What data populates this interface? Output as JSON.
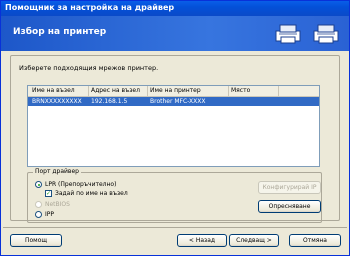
{
  "window": {
    "title": "Помощник за настройка на драйвер"
  },
  "header": {
    "title": "Избор на принтер"
  },
  "instruction": "Изберете подходящия мрежов принтер.",
  "table": {
    "columns": [
      "Име на възел",
      "Адрес на възел",
      "Име на принтер",
      "Място"
    ],
    "rows": [
      {
        "node_name": "BRNXXXXXXXXX",
        "node_address": "192.168.1.5",
        "printer_name": "Brother MFC-XXXX",
        "location": ""
      }
    ]
  },
  "port_group": {
    "legend": "Порт драйвер",
    "options": [
      {
        "label": "LPR (Препоръчително)",
        "checked": true,
        "enabled": true
      },
      {
        "label": "NetBIOS",
        "checked": false,
        "enabled": false
      },
      {
        "label": "IPP",
        "checked": false,
        "enabled": true
      }
    ],
    "checkbox_label": "Задай по име на възел"
  },
  "buttons": {
    "configure_ip": "Конфигурирай IP",
    "refresh": "Опресняване",
    "help": "Помощ",
    "back": "< Назад",
    "next": "Следващ >",
    "cancel": "Отмяна"
  },
  "colors": {
    "selection": "#316ac5",
    "header_blue": "#1d57c9"
  }
}
